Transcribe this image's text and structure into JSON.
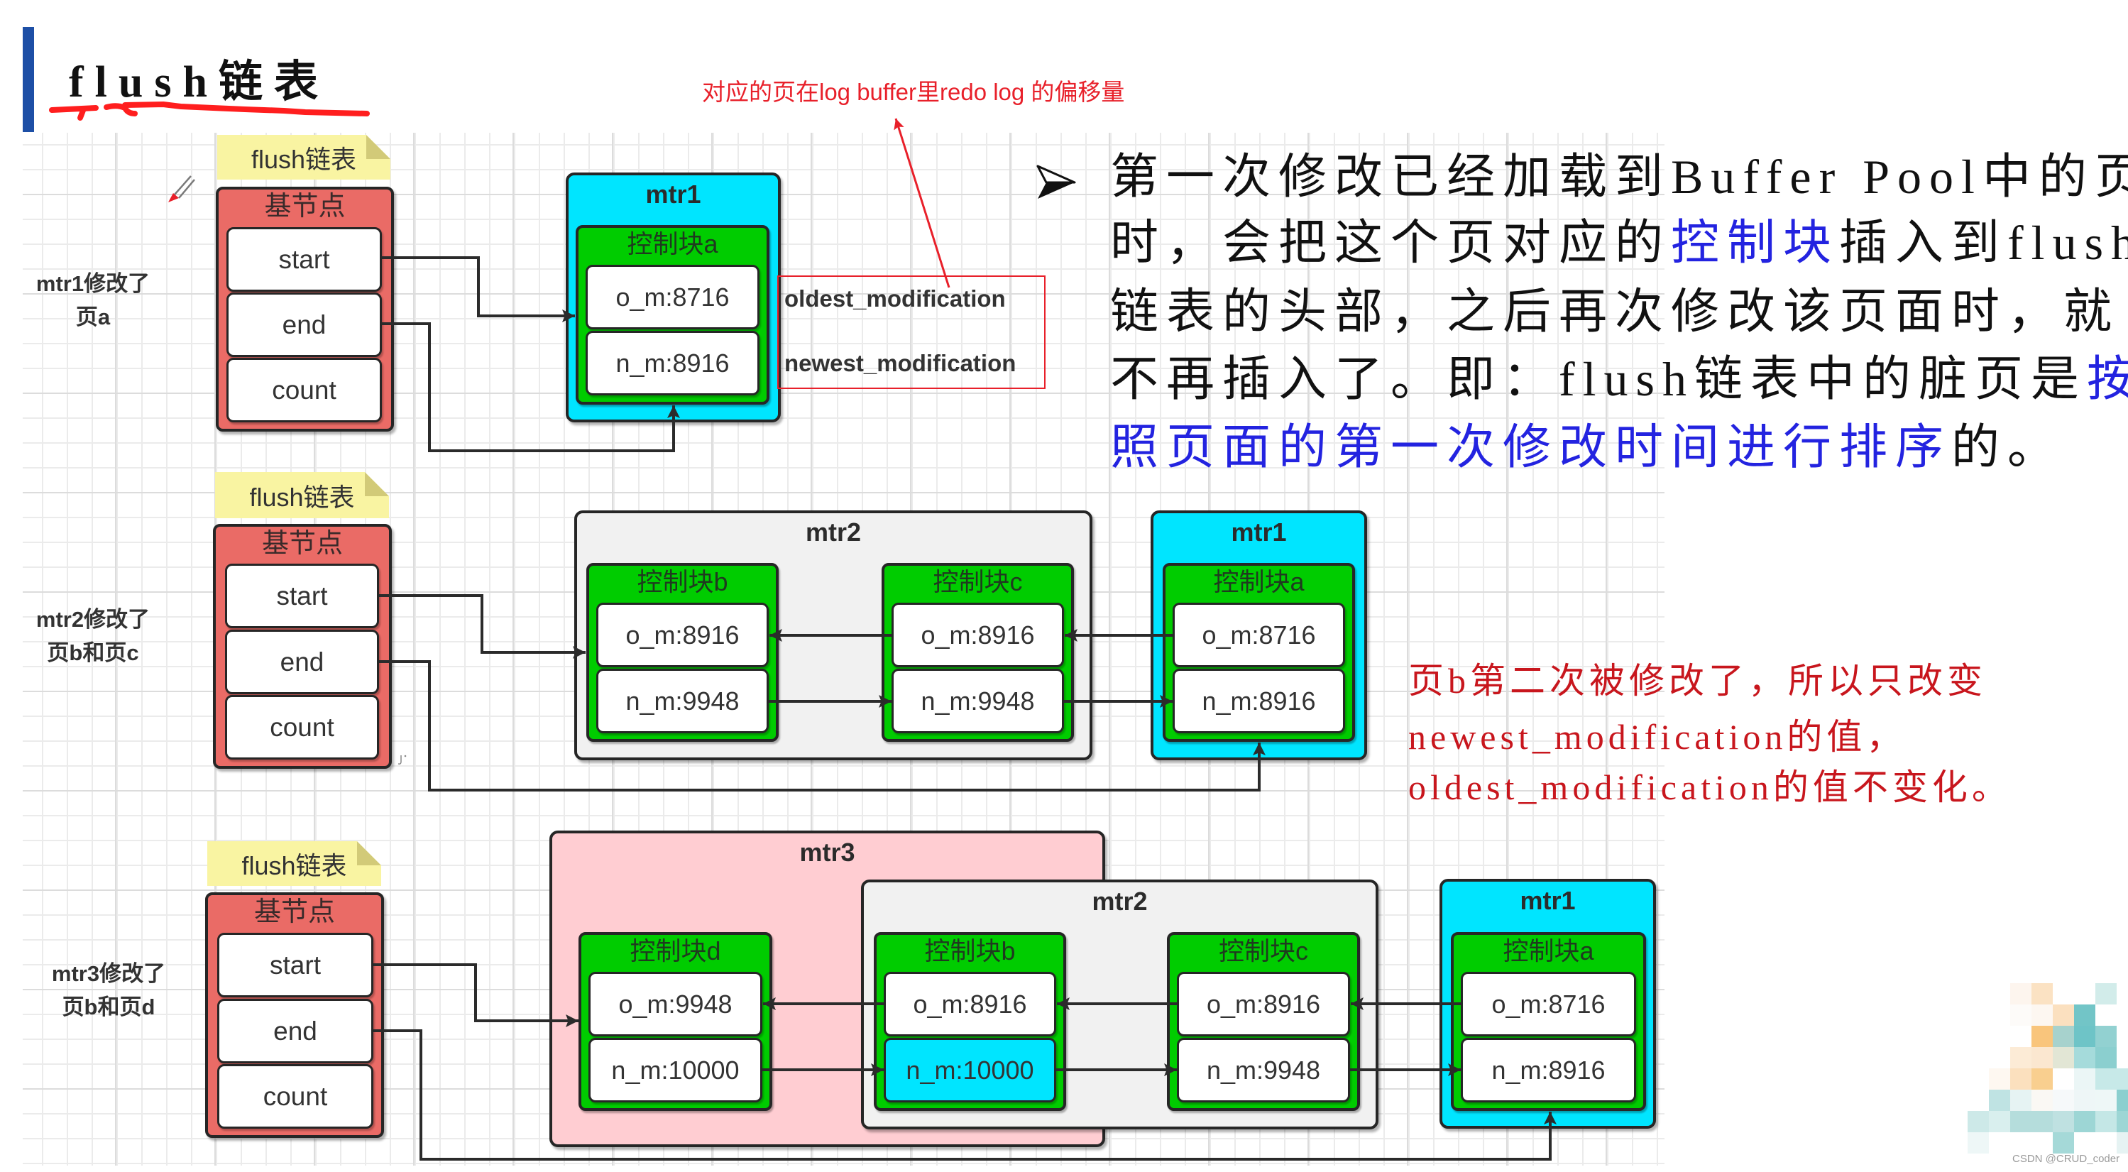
{
  "page": {
    "title": "flush链表"
  },
  "annotation": {
    "text": "对应的页在log buffer里redo log 的偏移量"
  },
  "explanation": {
    "bullet_icon": "arrowhead-bullet",
    "lines": [
      [
        {
          "text": "第一次修改已经加载到Buffer Pool中的页",
          "emphasis": false
        }
      ],
      [
        {
          "text": "时，会把这个页对应的",
          "emphasis": false
        },
        {
          "text": "控制块",
          "emphasis": true
        },
        {
          "text": "插入到flush",
          "emphasis": false
        }
      ],
      [
        {
          "text": "链表的头部，之后再次修改该页面时，就",
          "emphasis": false
        }
      ],
      [
        {
          "text": "不再插入了。即：flush链表中的脏页是",
          "emphasis": false
        },
        {
          "text": "按",
          "emphasis": true
        }
      ],
      [
        {
          "text": "照页面的第一次修改时间进行排序",
          "emphasis": true
        },
        {
          "text": "的。",
          "emphasis": false
        }
      ]
    ]
  },
  "side_note": {
    "lines": [
      "页b第二次被修改了，所以只改变",
      "newest_modification的值，",
      "oldest_modification的值不变化。"
    ]
  },
  "sections": [
    {
      "label": [
        "mtr1修改了",
        "页a"
      ],
      "note": "flush链表",
      "base_node": {
        "title": "基节点",
        "fields": [
          "start",
          "end",
          "count"
        ]
      },
      "groups": [
        {
          "name": "mtr1",
          "blocks": [
            {
              "title": "控制块a",
              "oldest": "o_m:8716",
              "newest": "n_m:8916"
            }
          ]
        }
      ],
      "legend": {
        "oldest": "oldest_modification",
        "newest": "newest_modification"
      }
    },
    {
      "label": [
        "mtr2修改了",
        "页b和页c"
      ],
      "note": "flush链表",
      "base_node": {
        "title": "基节点",
        "fields": [
          "start",
          "end",
          "count"
        ]
      },
      "groups": [
        {
          "name": "mtr2",
          "blocks": [
            {
              "title": "控制块b",
              "oldest": "o_m:8916",
              "newest": "n_m:9948"
            },
            {
              "title": "控制块c",
              "oldest": "o_m:8916",
              "newest": "n_m:9948"
            }
          ]
        },
        {
          "name": "mtr1",
          "blocks": [
            {
              "title": "控制块a",
              "oldest": "o_m:8716",
              "newest": "n_m:8916"
            }
          ]
        }
      ]
    },
    {
      "label": [
        "mtr3修改了",
        "页b和页d"
      ],
      "note": "flush链表",
      "base_node": {
        "title": "基节点",
        "fields": [
          "start",
          "end",
          "count"
        ]
      },
      "groups": [
        {
          "name": "mtr3",
          "blocks": [
            {
              "title": "控制块d",
              "oldest": "o_m:9948",
              "newest": "n_m:10000"
            }
          ]
        },
        {
          "name": "mtr2",
          "blocks": [
            {
              "title": "控制块b",
              "oldest": "o_m:8916",
              "newest": "n_m:10000",
              "newest_highlighted": true
            },
            {
              "title": "控制块c",
              "oldest": "o_m:8916",
              "newest": "n_m:9948"
            }
          ]
        },
        {
          "name": "mtr1",
          "blocks": [
            {
              "title": "控制块a",
              "oldest": "o_m:8716",
              "newest": "n_m:8916"
            }
          ]
        }
      ]
    }
  ],
  "watermark": {
    "text": "CSDN @CRUD_coder"
  },
  "colors": {
    "title_bar": "#1d4fa6",
    "annotation": "#e8202a",
    "emphasis": "#2323e0",
    "side_note": "#c8161d",
    "note": "#f9f4a2",
    "base_node": "#ea6b66",
    "control_block": "#00cc00",
    "mtr1": "#00e5ff",
    "mtr2": "#f1f1f1",
    "mtr3": "#ffcdd2",
    "highlight": "#00e5ff"
  }
}
